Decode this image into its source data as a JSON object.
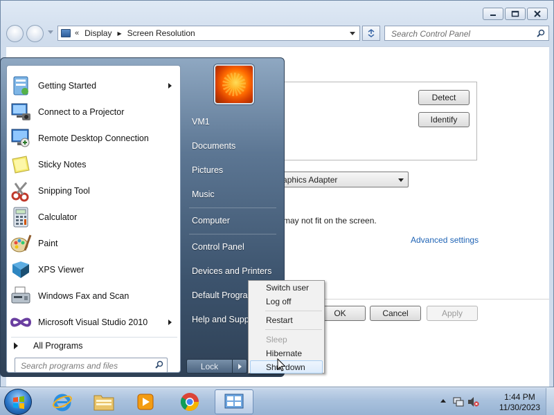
{
  "window": {
    "breadcrumb": [
      "Display",
      "Screen Resolution"
    ],
    "chevrons": "«",
    "search_placeholder": "Search Control Panel",
    "buttons": {
      "detect": "Detect",
      "identify": "Identify",
      "ok": "OK",
      "cancel": "Cancel",
      "apply": "Apply"
    },
    "display_dropdown": "andard VGA Graphics Adapter",
    "fit_text": "may not fit on the screen.",
    "advanced_link": "Advanced settings"
  },
  "start_menu": {
    "programs": [
      {
        "label": "Getting Started",
        "icon": "getting-started-icon",
        "submenu": true
      },
      {
        "label": "Connect to a Projector",
        "icon": "projector-icon",
        "submenu": false
      },
      {
        "label": "Remote Desktop Connection",
        "icon": "remote-desktop-icon",
        "submenu": false
      },
      {
        "label": "Sticky Notes",
        "icon": "sticky-notes-icon",
        "submenu": false
      },
      {
        "label": "Snipping Tool",
        "icon": "snipping-tool-icon",
        "submenu": false
      },
      {
        "label": "Calculator",
        "icon": "calculator-icon",
        "submenu": false
      },
      {
        "label": "Paint",
        "icon": "paint-icon",
        "submenu": false
      },
      {
        "label": "XPS Viewer",
        "icon": "xps-viewer-icon",
        "submenu": false
      },
      {
        "label": "Windows Fax and Scan",
        "icon": "fax-scan-icon",
        "submenu": false
      },
      {
        "label": "Microsoft Visual Studio 2010",
        "icon": "visual-studio-icon",
        "submenu": true
      }
    ],
    "all_programs": "All Programs",
    "search_placeholder": "Search programs and files",
    "right_items": [
      "VM1",
      "Documents",
      "Pictures",
      "Music",
      "Computer",
      "Control Panel",
      "Devices and Printers",
      "Default Programs",
      "Help and Support"
    ],
    "lock_label": "Lock"
  },
  "power_menu": {
    "items": [
      {
        "label": "Switch user",
        "disabled": false
      },
      {
        "label": "Log off",
        "disabled": false
      },
      {
        "label": "Restart",
        "disabled": false
      },
      {
        "label": "Sleep",
        "disabled": true
      },
      {
        "label": "Hibernate",
        "disabled": false
      },
      {
        "label": "Shut down",
        "disabled": false,
        "hovered": true
      }
    ]
  },
  "taskbar": {
    "apps": [
      "internet-explorer-icon",
      "windows-explorer-icon",
      "media-player-icon",
      "chrome-icon",
      "control-panel-icon"
    ],
    "clock_time": "1:44 PM",
    "clock_date": "11/30/2023"
  },
  "colors": {
    "link": "#1e63b5",
    "start_menu_dark": "#2f4156",
    "accent_orange": "#ff6a00"
  }
}
